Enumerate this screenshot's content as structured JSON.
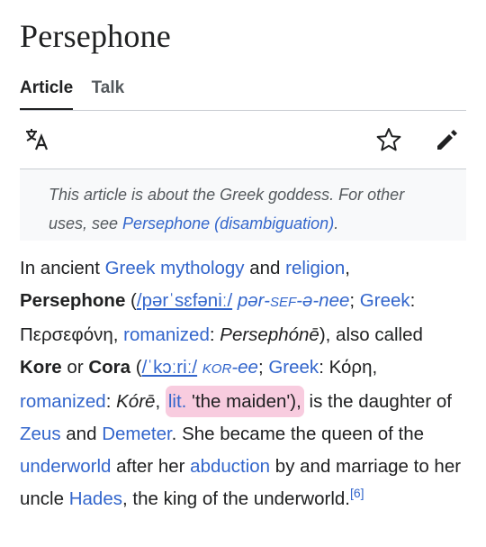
{
  "page": {
    "title": "Persephone"
  },
  "tabs": [
    {
      "label": "Article",
      "active": true
    },
    {
      "label": "Talk",
      "active": false
    }
  ],
  "toolbar": {
    "language_icon": "translate-icon",
    "watch_icon": "star-icon",
    "edit_icon": "pencil-icon"
  },
  "hatnote": {
    "text": "This article is about the Greek goddess. For other uses, see ",
    "link": "Persephone (disambiguation)",
    "end": "."
  },
  "content": {
    "p1": "In ancient ",
    "link_greek_mythology": "Greek mythology",
    "p2": " and ",
    "link_religion": "religion",
    "p3": ",",
    "name1": "Persephone",
    "p4": " (",
    "ipa1": "/pərˈsɛfəniː/",
    "resp1_a": "pər-",
    "resp1_b": "SEF",
    "resp1_c": "-ə-nee",
    "p5": "; ",
    "link_greek1": "Greek",
    "p6": ": Περσεφόνη, ",
    "link_romanized1": "romanized",
    "p7": ": ",
    "translit1": "Persephónē",
    "p8": "), also called ",
    "name2": "Kore",
    "p9": " or ",
    "name3": "Cora",
    "p10": " (",
    "ipa2": "/ˈkɔːriː/",
    "resp2_a": "KOR",
    "resp2_b": "-ee",
    "p11": "; ",
    "link_greek2": "Greek",
    "p12": ": Κόρη, ",
    "link_romanized2": "romanized",
    "p13": ": ",
    "translit2": "Kórē",
    "p14": ", ",
    "link_lit": "lit.",
    "p15": " 'the maiden'),",
    "p16": " is the daughter of ",
    "link_zeus": "Zeus",
    "p17": " and ",
    "link_demeter": "Demeter",
    "p18": ". She became the queen of the ",
    "link_underworld": "underworld",
    "p19": " after her ",
    "link_abduction": "abduction",
    "p20": " by and marriage to her uncle ",
    "link_hades": "Hades",
    "p21": ", the king of the underworld.",
    "ref": "[6]"
  },
  "colors": {
    "link": "#3366cc",
    "highlight": "#ec78aa",
    "text": "#202122"
  }
}
